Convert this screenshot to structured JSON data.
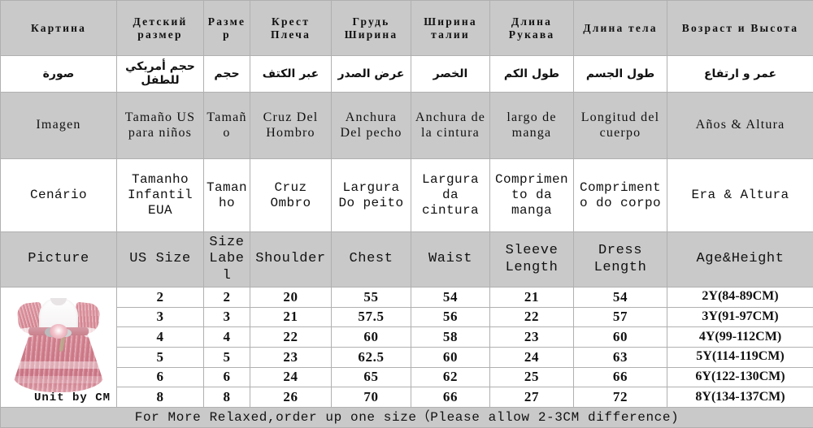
{
  "table": {
    "header_rows": [
      {
        "lang": "ru",
        "cells": [
          "Картина",
          "Детский размер",
          "Размер",
          "Крест Плеча",
          "Грудь Ширина",
          "Ширина талии",
          "Длина Рукава",
          "Длина тела",
          "Возраст и Высота"
        ]
      },
      {
        "lang": "ar",
        "cells": [
          "صورة",
          "حجم أمريكي للطفل",
          "حجم",
          "عبر الكتف",
          "عرض الصدر",
          "الخصر",
          "طول الكم",
          "طول الجسم",
          "عمر و ارتفاع"
        ]
      },
      {
        "lang": "es",
        "cells": [
          "Imagen",
          "Tamaño US para niños",
          "Tamaño",
          "Cruz Del Hombro",
          "Anchura Del pecho",
          "Anchura de la cintura",
          "largo de manga",
          "Longitud del cuerpo",
          "Años & Altura"
        ]
      },
      {
        "lang": "pt",
        "cells": [
          "Cenário",
          "Tamanho Infantil EUA",
          "Tamanho",
          "Cruz Ombro",
          "Largura Do peito",
          "Largura da cintura",
          "Comprimento da manga",
          "Comprimento do corpo",
          "Era & Altura"
        ]
      },
      {
        "lang": "en",
        "cells": [
          "Picture",
          "US Size",
          "Size Label",
          "Shoulder",
          "Chest",
          "Waist",
          "Sleeve Length",
          "Dress Length",
          "Age&Height"
        ]
      }
    ],
    "picture_cell": {
      "product": "girls-pink-tulle-dress",
      "unit_note": "Unit by CM"
    },
    "rows": [
      {
        "us_size": "2",
        "size_label": "2",
        "shoulder": "20",
        "chest": "55",
        "waist": "54",
        "sleeve_length": "21",
        "dress_length": "54",
        "age_height": "2Y(84-89CM)"
      },
      {
        "us_size": "3",
        "size_label": "3",
        "shoulder": "21",
        "chest": "57.5",
        "waist": "56",
        "sleeve_length": "22",
        "dress_length": "57",
        "age_height": "3Y(91-97CM)"
      },
      {
        "us_size": "4",
        "size_label": "4",
        "shoulder": "22",
        "chest": "60",
        "waist": "58",
        "sleeve_length": "23",
        "dress_length": "60",
        "age_height": "4Y(99-112CM)"
      },
      {
        "us_size": "5",
        "size_label": "5",
        "shoulder": "23",
        "chest": "62.5",
        "waist": "60",
        "sleeve_length": "24",
        "dress_length": "63",
        "age_height": "5Y(114-119CM)"
      },
      {
        "us_size": "6",
        "size_label": "6",
        "shoulder": "24",
        "chest": "65",
        "waist": "62",
        "sleeve_length": "25",
        "dress_length": "66",
        "age_height": "6Y(122-130CM)"
      },
      {
        "us_size": "8",
        "size_label": "8",
        "shoulder": "26",
        "chest": "70",
        "waist": "66",
        "sleeve_length": "27",
        "dress_length": "72",
        "age_height": "8Y(134-137CM)"
      }
    ],
    "footer": "For More Relaxed,order up one size（Please allow 2-3CM difference)"
  },
  "colors": {
    "header_gray": "#c9c9c9",
    "cell_white": "#ffffff",
    "grid_line": "#b0b0b0",
    "text": "#111111",
    "dress_pink": "#d2818f",
    "dress_white": "#ffffff"
  }
}
